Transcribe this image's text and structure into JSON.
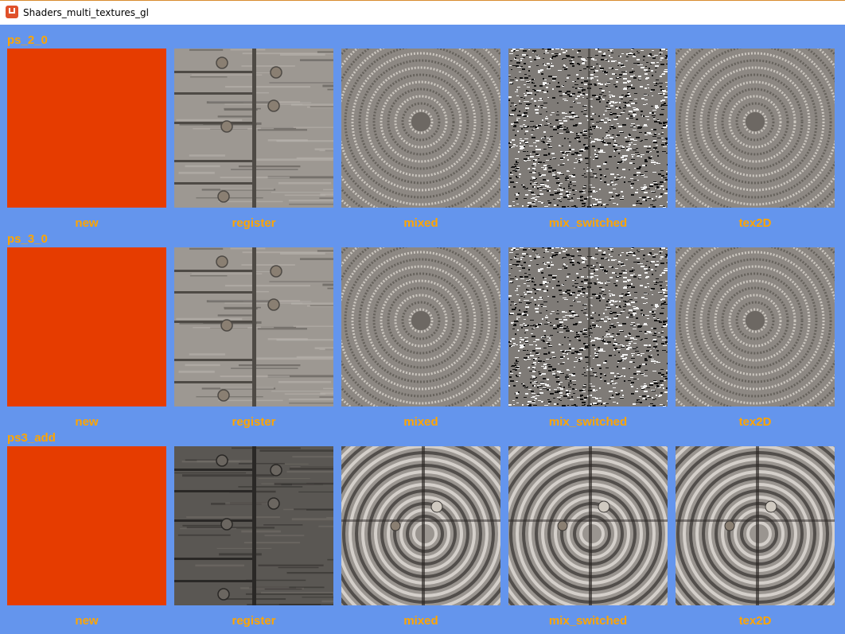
{
  "window": {
    "title": "Shaders_multi_textures_gl",
    "icon": "monogame-app-icon",
    "background_color": "#6495ED",
    "label_color": "#FFA500"
  },
  "sections": [
    {
      "label": "ps_2_0",
      "tiles": [
        {
          "caption": "new",
          "kind": "solid"
        },
        {
          "caption": "register",
          "kind": "wood"
        },
        {
          "caption": "mixed",
          "kind": "rings-gray"
        },
        {
          "caption": "mix_switched",
          "kind": "noise"
        },
        {
          "caption": "tex2D",
          "kind": "rings-gray"
        }
      ]
    },
    {
      "label": "ps_3_0",
      "tiles": [
        {
          "caption": "new",
          "kind": "solid"
        },
        {
          "caption": "register",
          "kind": "wood"
        },
        {
          "caption": "mixed",
          "kind": "rings-gray"
        },
        {
          "caption": "mix_switched",
          "kind": "noise"
        },
        {
          "caption": "tex2D",
          "kind": "rings-gray"
        }
      ]
    },
    {
      "label": "ps3_add",
      "tiles": [
        {
          "caption": "new",
          "kind": "solid"
        },
        {
          "caption": "register",
          "kind": "wood-dark"
        },
        {
          "caption": "mixed",
          "kind": "rings-wood"
        },
        {
          "caption": "mix_switched",
          "kind": "rings-wood"
        },
        {
          "caption": "tex2D",
          "kind": "rings-wood"
        }
      ]
    }
  ],
  "colors": {
    "solid_tile": "#E63C00"
  }
}
